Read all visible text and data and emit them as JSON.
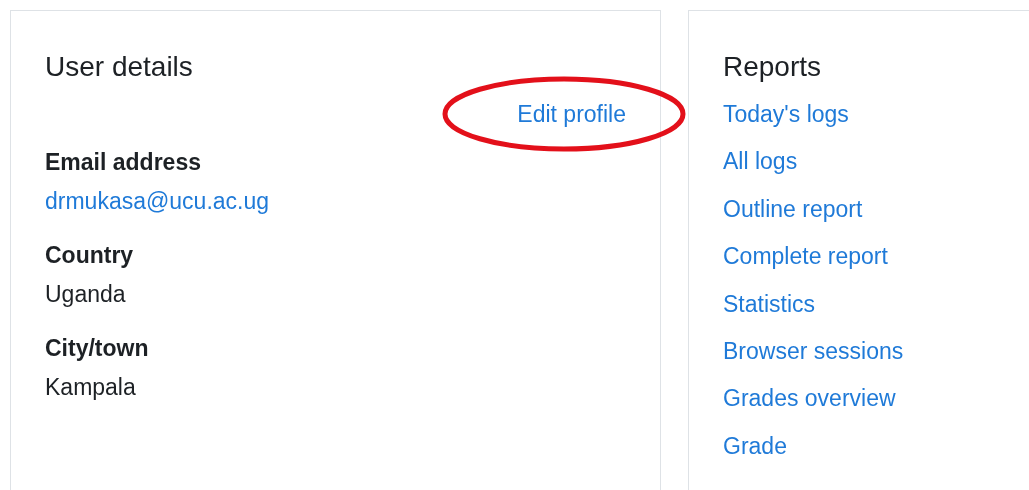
{
  "user_details": {
    "title": "User details",
    "edit_link": {
      "label": "Edit profile",
      "circled": true
    },
    "fields": [
      {
        "label": "Email address",
        "value": "drmukasa@ucu.ac.ug",
        "kind": "link"
      },
      {
        "label": "Country",
        "value": "Uganda",
        "kind": "text"
      },
      {
        "label": "City/town",
        "value": "Kampala",
        "kind": "text"
      }
    ]
  },
  "reports": {
    "title": "Reports",
    "links": [
      "Today's logs",
      "All logs",
      "Outline report",
      "Complete report",
      "Statistics",
      "Browser sessions",
      "Grades overview",
      "Grade"
    ]
  }
}
